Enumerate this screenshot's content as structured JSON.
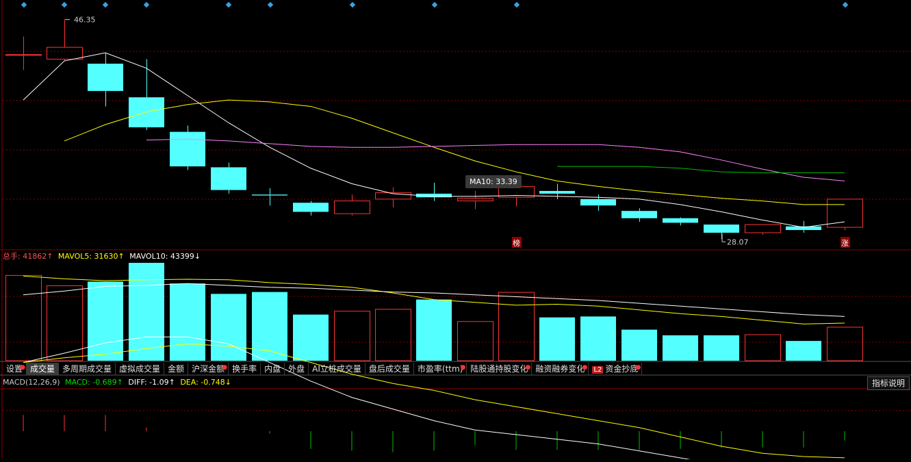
{
  "colors": {
    "up": "#ff3333",
    "down": "#54ffff",
    "ma5": "#ffffff",
    "ma10": "#ffff00",
    "ma20": "#ff80ff",
    "ma30": "#00c000",
    "grid": "#8b0000"
  },
  "price_chart": {
    "high_label": "46.35",
    "low_label": "28.07",
    "badges": [
      "榜",
      "涨"
    ],
    "tooltip": "MA10: 33.39"
  },
  "volume_legend": {
    "total": "总手: 41862↑",
    "mavol5": "MAVOL5: 31630↑",
    "mavol10": "MAVOL10: 43399↓"
  },
  "tabs": [
    {
      "label": "设置",
      "dot": true,
      "active": false
    },
    {
      "label": "成交量",
      "dot": false,
      "active": true
    },
    {
      "label": "多周期成交量",
      "dot": false,
      "active": false
    },
    {
      "label": "虚拟成交量",
      "dot": false,
      "active": false
    },
    {
      "label": "金额",
      "dot": false,
      "active": false
    },
    {
      "label": "沪深金额",
      "dot": true,
      "active": false
    },
    {
      "label": "换手率",
      "dot": false,
      "active": false
    },
    {
      "label": "内盘",
      "dot": false,
      "active": false
    },
    {
      "label": "外盘",
      "dot": false,
      "active": false
    },
    {
      "label": "AI立桩成交量",
      "dot": false,
      "active": false
    },
    {
      "label": "盘后成交量",
      "dot": false,
      "active": false
    },
    {
      "label": "市盈率(ttm)",
      "dot": true,
      "active": false
    },
    {
      "label": "陆股通持股变化",
      "dot": true,
      "active": false
    },
    {
      "label": "融资融券变化",
      "dot": true,
      "active": false
    },
    {
      "label": "资金抄底",
      "dot": true,
      "active": false,
      "prefix": "L2"
    }
  ],
  "macd_legend": {
    "name": "MACD(12,26,9)",
    "macd": "MACD: -0.689↑",
    "diff": "DIFF: -1.09↑",
    "dea": "DEA: -0.748↓"
  },
  "indicator_button": "指标说明",
  "chart_data": {
    "type": "candlestick",
    "candles": [
      {
        "o": 42.5,
        "h": 44.5,
        "l": 40.8,
        "c": 42.5
      },
      {
        "o": 42.0,
        "h": 46.35,
        "l": 41.8,
        "c": 43.3
      },
      {
        "o": 41.5,
        "h": 42.7,
        "l": 36.8,
        "c": 38.5
      },
      {
        "o": 37.8,
        "h": 42.0,
        "l": 34.2,
        "c": 34.5
      },
      {
        "o": 34.0,
        "h": 34.7,
        "l": 29.8,
        "c": 30.2
      },
      {
        "o": 30.1,
        "h": 30.6,
        "l": 27.2,
        "c": 27.6
      },
      {
        "o": 27.1,
        "h": 27.8,
        "l": 25.9,
        "c": 27.0
      },
      {
        "o": 26.2,
        "h": 26.4,
        "l": 24.8,
        "c": 25.2
      },
      {
        "o": 25.0,
        "h": 27.1,
        "l": 24.8,
        "c": 26.4
      },
      {
        "o": 26.6,
        "h": 27.9,
        "l": 25.7,
        "c": 27.3
      },
      {
        "o": 27.2,
        "h": 28.4,
        "l": 26.4,
        "c": 26.8
      },
      {
        "o": 26.4,
        "h": 27.5,
        "l": 25.5,
        "c": 26.7
      },
      {
        "o": 26.8,
        "h": 29.2,
        "l": 25.8,
        "c": 28.0
      },
      {
        "o": 27.5,
        "h": 28.3,
        "l": 26.6,
        "c": 27.2
      },
      {
        "o": 26.6,
        "h": 27.1,
        "l": 25.3,
        "c": 25.9
      },
      {
        "o": 25.3,
        "h": 25.6,
        "l": 24.1,
        "c": 24.5
      },
      {
        "o": 24.5,
        "h": 24.6,
        "l": 23.7,
        "c": 24.0
      },
      {
        "o": 23.8,
        "h": 23.8,
        "l": 22.2,
        "c": 22.9
      },
      {
        "o": 22.9,
        "h": 23.8,
        "l": 22.7,
        "c": 23.8
      },
      {
        "o": 23.6,
        "h": 24.2,
        "l": 22.9,
        "c": 23.2
      },
      {
        "o": 23.5,
        "h": 26.6,
        "l": 23.2,
        "c": 26.6
      }
    ],
    "ma5": [
      37.5,
      41.8,
      42.7,
      41.0,
      38.0,
      35.0,
      32.3,
      30.0,
      28.3,
      27.2,
      26.9,
      26.9,
      27.0,
      26.9,
      26.8,
      26.6,
      26.0,
      25.2,
      24.3,
      23.5,
      24.1
    ],
    "ma10": [
      null,
      33.0,
      34.8,
      36.2,
      37.0,
      37.5,
      37.3,
      36.8,
      35.5,
      33.9,
      32.3,
      30.8,
      29.6,
      28.6,
      28.0,
      27.5,
      27.1,
      26.7,
      26.4,
      26.0,
      26.0
    ],
    "ma20": [
      null,
      null,
      null,
      33.1,
      33.2,
      33.0,
      32.7,
      32.4,
      32.3,
      32.3,
      32.4,
      32.5,
      32.6,
      32.6,
      32.6,
      32.3,
      31.8,
      30.9,
      29.9,
      29.0,
      28.6
    ],
    "ma30": [
      null,
      null,
      null,
      null,
      null,
      null,
      null,
      null,
      null,
      null,
      null,
      null,
      null,
      30.2,
      30.2,
      30.2,
      30.0,
      29.6,
      29.5,
      29.5,
      29.5
    ],
    "volumes": [
      91000,
      80000,
      84000,
      104000,
      82000,
      71000,
      73000,
      49000,
      53000,
      55000,
      65000,
      42000,
      73000,
      46000,
      47000,
      33000,
      27000,
      27000,
      28000,
      21000,
      36000
    ],
    "mavol5": [
      90000,
      87000,
      85000,
      86000,
      86500,
      86000,
      83000,
      81000,
      78000,
      72000,
      65000,
      62000,
      59000,
      60000,
      58000,
      54000,
      50000,
      47000,
      43000,
      39000,
      40000
    ],
    "mavol10": [
      70000,
      74000,
      79000,
      80000,
      82000,
      80000,
      78000,
      77000,
      75000,
      73000,
      72000,
      70000,
      68000,
      66000,
      64000,
      61000,
      58000,
      55000,
      52000,
      49000,
      47000
    ],
    "macd_hist": [
      0.35,
      0.35,
      0.35,
      0.08,
      0.0,
      0.0,
      -0.05,
      -0.38,
      -0.42,
      -0.45,
      -0.42,
      -0.3,
      -0.4,
      -0.4,
      -0.4,
      -0.4,
      -0.38,
      -0.35,
      -0.35,
      -0.35,
      -0.2
    ],
    "diff": [
      1.3,
      1.5,
      1.72,
      1.85,
      1.85,
      1.7,
      1.3,
      0.9,
      0.55,
      0.3,
      0.05,
      -0.15,
      -0.25,
      -0.35,
      -0.45,
      -0.6,
      -0.75,
      -0.9,
      -1.05,
      -1.1,
      -1.09
    ],
    "dea": [
      1.3,
      1.4,
      1.48,
      1.6,
      1.7,
      1.65,
      1.55,
      1.3,
      1.05,
      0.85,
      0.7,
      0.5,
      0.35,
      0.2,
      0.05,
      -0.1,
      -0.3,
      -0.5,
      -0.65,
      -0.72,
      -0.748
    ]
  }
}
